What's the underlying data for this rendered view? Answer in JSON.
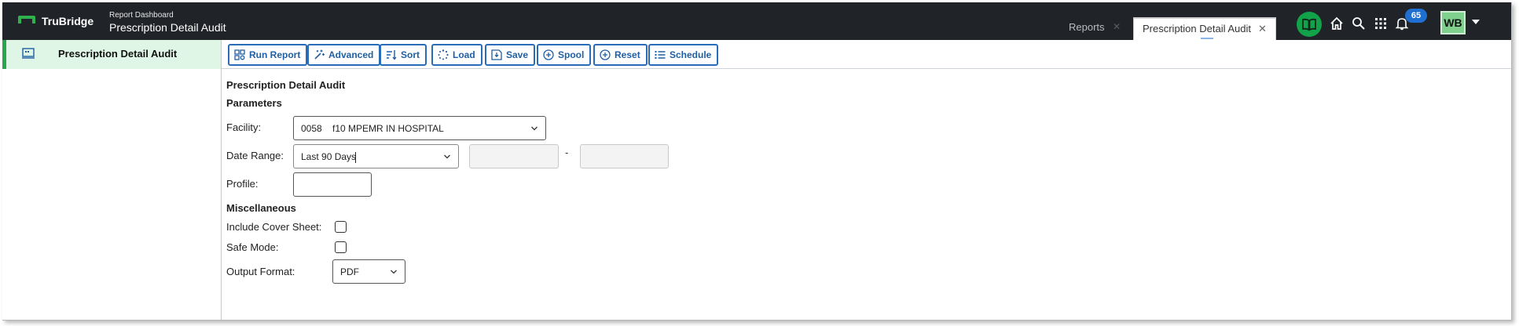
{
  "header": {
    "brand": "TruBridge",
    "subtitle": "Report Dashboard",
    "title": "Prescription Detail Audit",
    "tabs": [
      {
        "label": "Reports"
      },
      {
        "label": "Prescription Detail Audit"
      }
    ],
    "notification_count": "65",
    "user_initials": "WB"
  },
  "sidebar": {
    "items": [
      {
        "label": "Prescription Detail Audit"
      }
    ]
  },
  "toolbar": {
    "buttons": [
      {
        "label": "Run Report",
        "icon": "run-report-icon"
      },
      {
        "label": "Advanced",
        "icon": "magic-wand-icon"
      },
      {
        "label": "Sort",
        "icon": "sort-icon"
      },
      {
        "label": "Load",
        "icon": "load-spinner-icon"
      },
      {
        "label": "Save",
        "icon": "save-icon"
      },
      {
        "label": "Spool",
        "icon": "plus-circle-icon"
      },
      {
        "label": "Reset",
        "icon": "plus-circle-icon"
      },
      {
        "label": "Schedule",
        "icon": "list-icon"
      }
    ]
  },
  "form": {
    "title": "Prescription Detail Audit",
    "parameters_heading": "Parameters",
    "facility_label": "Facility:",
    "facility_value": "0058    f10 MPEMR IN HOSPITAL",
    "date_range_label": "Date Range:",
    "date_range_value": "Last 90 Days",
    "date_from": "",
    "date_to": "",
    "date_separator": "-",
    "profile_label": "Profile:",
    "profile_value": "",
    "misc_heading": "Miscellaneous",
    "cover_sheet_label": "Include Cover Sheet:",
    "cover_sheet_checked": false,
    "safe_mode_label": "Safe Mode:",
    "safe_mode_checked": false,
    "output_format_label": "Output Format:",
    "output_format_value": "PDF"
  },
  "colors": {
    "topbar": "#202328",
    "accent_green": "#27a74a",
    "toolbar_blue": "#2a6cb8",
    "badge_blue": "#1f6fd0",
    "sidebar_active_bg": "#dff5e5"
  }
}
